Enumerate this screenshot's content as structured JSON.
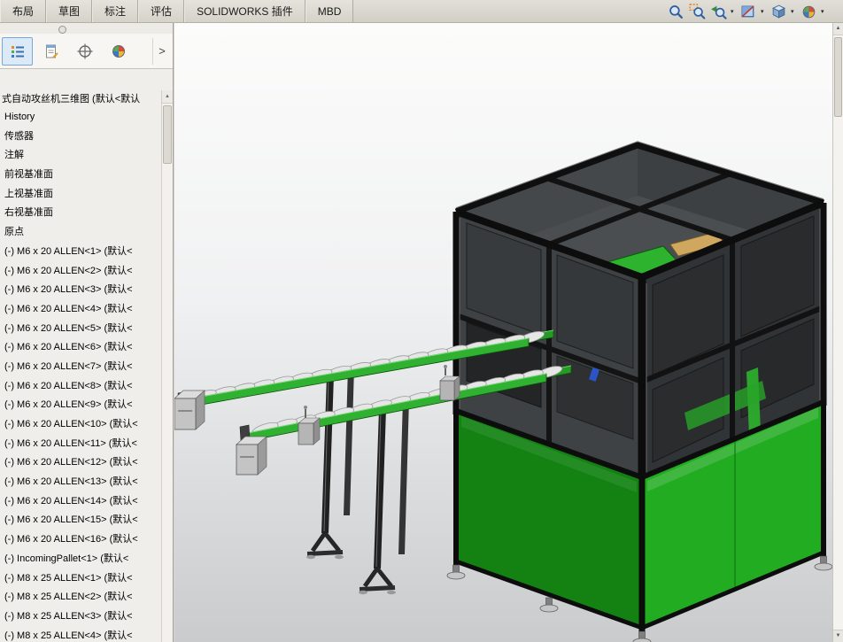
{
  "ribbon": {
    "tabs": [
      "布局",
      "草图",
      "标注",
      "评估",
      "SOLIDWORKS 插件",
      "MBD"
    ]
  },
  "headsup": {
    "caret_glyph": "▾",
    "icons": [
      {
        "name": "zoom-to-fit"
      },
      {
        "name": "zoom-to-area"
      },
      {
        "name": "previous-view",
        "dropdown": true
      },
      {
        "name": "section-view",
        "dropdown": true
      },
      {
        "name": "view-orientation",
        "dropdown": true
      },
      {
        "name": "edit-appearance",
        "dropdown": true
      }
    ]
  },
  "panel": {
    "expand_glyph": ">",
    "tabs": [
      {
        "name": "feature-manager"
      },
      {
        "name": "property-manager"
      },
      {
        "name": "dimxpert"
      },
      {
        "name": "display-manager"
      }
    ],
    "tree": {
      "title": "式自动攻丝机三维图  (默认<默认",
      "scroll_up_glyph": "▲",
      "items": [
        "History",
        "传感器",
        "注解",
        "前视基准面",
        "上视基准面",
        "右视基准面",
        "原点",
        "(-) M6 x 20 ALLEN<1> (默认<",
        "(-) M6 x 20 ALLEN<2> (默认<",
        "(-) M6 x 20 ALLEN<3> (默认<",
        "(-) M6 x 20 ALLEN<4> (默认<",
        "(-) M6 x 20 ALLEN<5> (默认<",
        "(-) M6 x 20 ALLEN<6> (默认<",
        "(-) M6 x 20 ALLEN<7> (默认<",
        "(-) M6 x 20 ALLEN<8> (默认<",
        "(-) M6 x 20 ALLEN<9> (默认<",
        "(-) M6 x 20 ALLEN<10> (默认<",
        "(-) M6 x 20 ALLEN<11> (默认<",
        "(-) M6 x 20 ALLEN<12> (默认<",
        "(-) M6 x 20 ALLEN<13> (默认<",
        "(-) M6 x 20 ALLEN<14> (默认<",
        "(-) M6 x 20 ALLEN<15> (默认<",
        "(-) M6 x 20 ALLEN<16> (默认<",
        "(-) IncomingPallet<1> (默认<",
        "(-) M8 x 25 ALLEN<1> (默认<",
        "(-) M8 x 25 ALLEN<2> (默认<",
        "(-) M8 x 25 ALLEN<3> (默认<",
        "(-) M8 x 25 ALLEN<4> (默认<"
      ]
    }
  },
  "scrollbar": {
    "up": "▲",
    "down": "▼"
  },
  "colors": {
    "cabinet_green_front": "#22ac22",
    "cabinet_green_side": "#138213",
    "rail_green": "#31b131",
    "rail_green_far": "#279927",
    "chute_green": "#2db32d",
    "panel_dark": "#313436",
    "panel_left_dark": "#3f4244",
    "frame_black": "#0d0d0d",
    "background_top": "#fcfcfb",
    "background_bottom": "#c9cbcd"
  }
}
